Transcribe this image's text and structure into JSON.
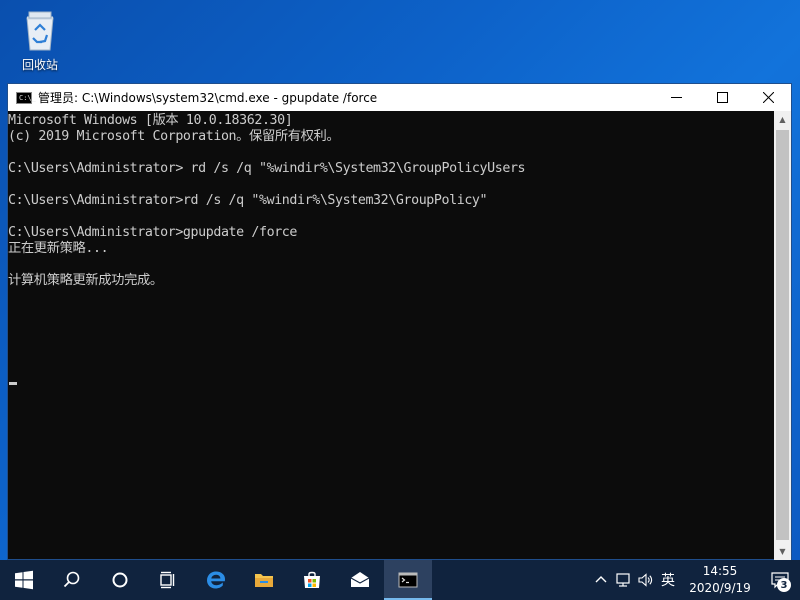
{
  "desktop": {
    "recycle_bin_label": "回收站",
    "recycle_bin_icon": "recycle-bin-icon"
  },
  "window": {
    "title": "管理员: C:\\Windows\\system32\\cmd.exe - gpupdate  /force",
    "app_icon_text": "C:\\_",
    "buttons": [
      "minimize",
      "maximize",
      "close"
    ]
  },
  "console": {
    "text_color": "#cccccc",
    "background": "#0c0c0c",
    "lines": [
      "Microsoft Windows [版本 10.0.18362.30]",
      "(c) 2019 Microsoft Corporation。保留所有权利。",
      "",
      "C:\\Users\\Administrator> rd /s /q \"%windir%\\System32\\GroupPolicyUsers",
      "",
      "C:\\Users\\Administrator>rd /s /q \"%windir%\\System32\\GroupPolicy\"",
      "",
      "C:\\Users\\Administrator>gpupdate /force",
      "正在更新策略...",
      "",
      "计算机策略更新成功完成。",
      ""
    ]
  },
  "taskbar": {
    "background": "#10233e",
    "items": [
      {
        "name": "start-button",
        "icon": "windows-logo-icon"
      },
      {
        "name": "search-button",
        "icon": "search-icon"
      },
      {
        "name": "cortana-button",
        "icon": "cortana-ring-icon"
      },
      {
        "name": "task-view-button",
        "icon": "task-view-icon"
      },
      {
        "name": "edge-button",
        "icon": "edge-icon"
      },
      {
        "name": "file-explorer-button",
        "icon": "folder-icon"
      },
      {
        "name": "store-button",
        "icon": "store-bag-icon"
      },
      {
        "name": "mail-button",
        "icon": "mail-icon"
      },
      {
        "name": "cmd-button",
        "icon": "cmd-icon",
        "active": true
      }
    ],
    "tray": {
      "chevron": "^",
      "ime_label": "英",
      "time": "14:55",
      "date": "2020/9/19",
      "notification_count": "3"
    }
  }
}
